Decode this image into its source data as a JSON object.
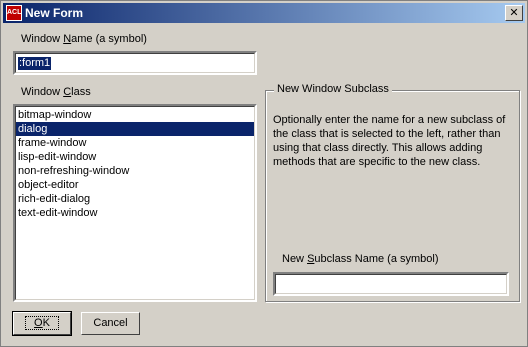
{
  "window": {
    "title": "New Form",
    "app_icon_text": "ACL",
    "close_glyph": "✕"
  },
  "window_name": {
    "label_before": "Window ",
    "label_accel": "N",
    "label_after": "ame (a symbol)",
    "value": ":form1"
  },
  "window_class": {
    "label_before": "Window ",
    "label_accel": "C",
    "label_after": "lass",
    "items": [
      {
        "label": "bitmap-window",
        "selected": false
      },
      {
        "label": "dialog",
        "selected": true
      },
      {
        "label": "frame-window",
        "selected": false
      },
      {
        "label": "lisp-edit-window",
        "selected": false
      },
      {
        "label": "non-refreshing-window",
        "selected": false
      },
      {
        "label": "object-editor",
        "selected": false
      },
      {
        "label": "rich-edit-dialog",
        "selected": false
      },
      {
        "label": "text-edit-window",
        "selected": false
      }
    ]
  },
  "subclass_group": {
    "legend": "New Window Subclass",
    "description": "Optionally enter the name for a new subclass of the class that is selected to the left, rather than using that class directly.  This allows adding methods that are specific to the new class.",
    "name_label_before": "New ",
    "name_label_accel": "S",
    "name_label_after": "ubclass Name (a symbol)",
    "name_value": ""
  },
  "buttons": {
    "ok_accel": "O",
    "ok_rest": "K",
    "cancel": "Cancel"
  }
}
